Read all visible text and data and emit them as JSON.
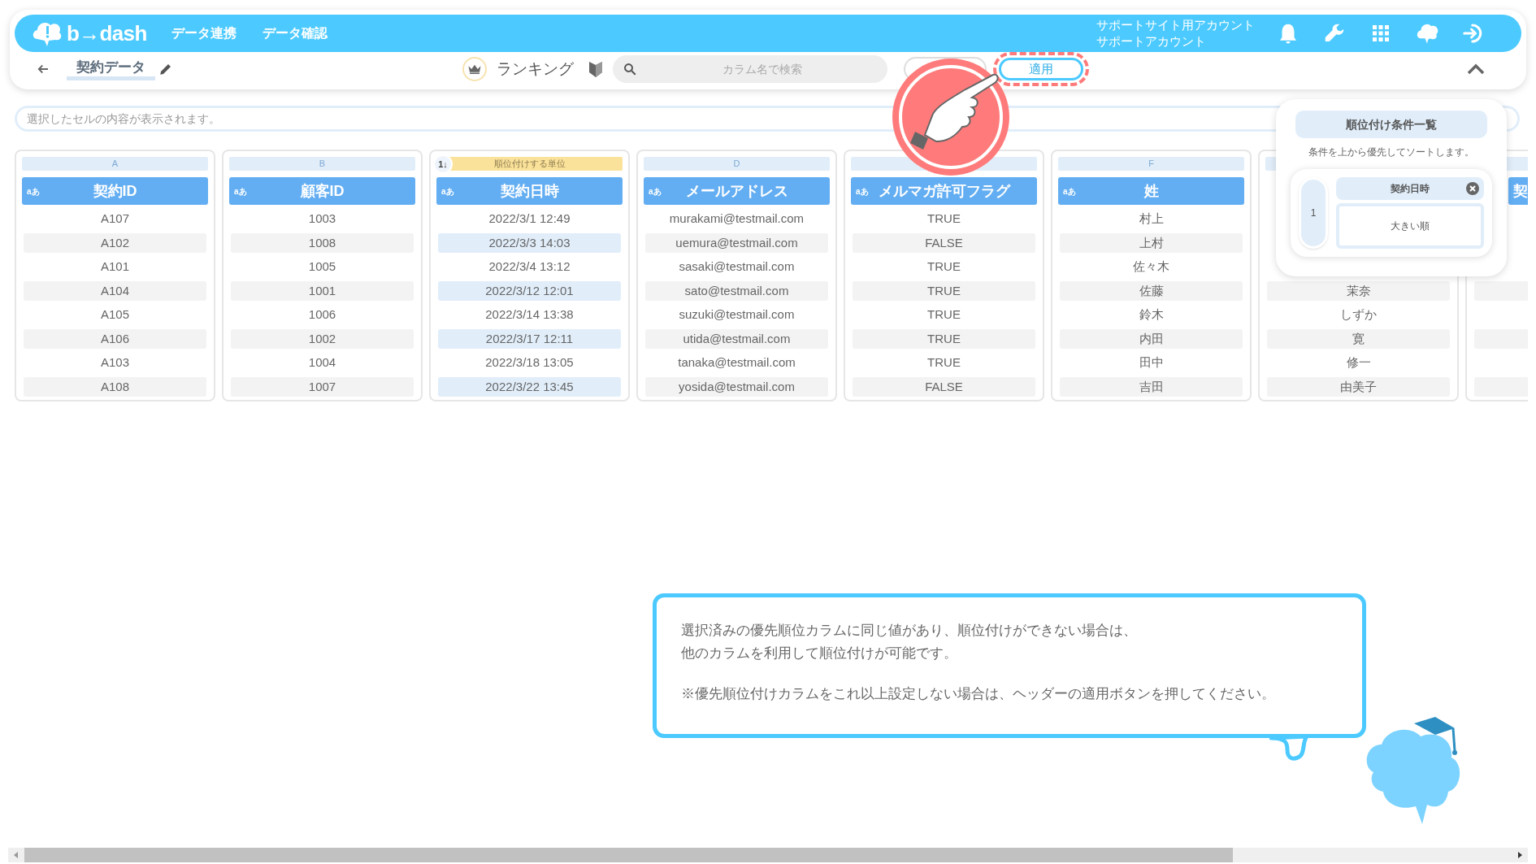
{
  "header": {
    "logo": "b→dash",
    "nav": [
      "データ連携",
      "データ確認"
    ],
    "account": [
      "サポートサイト用アカウント",
      "サポートアカウント"
    ]
  },
  "toolbar": {
    "title": "契約データ",
    "mode": "ランキング",
    "search": {
      "placeholder": "カラム名で検索"
    },
    "apply": "適用"
  },
  "cell_viewer": {
    "placeholder": "選択したセルの内容が表示されます。"
  },
  "ranking_label": {
    "order": "1↓",
    "text": "順位付けする単位"
  },
  "columns": [
    {
      "letter": "A",
      "header": "契約ID",
      "type_badge": "aあ",
      "ranked": false,
      "cells": [
        "A107",
        "A102",
        "A101",
        "A104",
        "A105",
        "A106",
        "A103",
        "A108"
      ]
    },
    {
      "letter": "B",
      "header": "顧客ID",
      "type_badge": "aあ",
      "ranked": false,
      "cells": [
        "1003",
        "1008",
        "1005",
        "1001",
        "1006",
        "1002",
        "1004",
        "1007"
      ]
    },
    {
      "header": "契約日時",
      "type_badge": "aあ",
      "ranked": true,
      "cells": [
        "2022/3/1 12:49",
        "2022/3/3 14:03",
        "2022/3/4 13:12",
        "2022/3/12 12:01",
        "2022/3/14 13:38",
        "2022/3/17 12:11",
        "2022/3/18 13:05",
        "2022/3/22 13:45"
      ]
    },
    {
      "letter": "D",
      "header": "メールアドレス",
      "type_badge": "aあ",
      "ranked": false,
      "cells": [
        "murakami@testmail.com",
        "uemura@testmail.com",
        "sasaki@testmail.com",
        "sato@testmail.com",
        "suzuki@testmail.com",
        "utida@testmail.com",
        "tanaka@testmail.com",
        "yosida@testmail.com"
      ]
    },
    {
      "header": "メルマガ許可フラグ",
      "type_badge": "aあ",
      "ranked": false,
      "cells": [
        "TRUE",
        "FALSE",
        "TRUE",
        "TRUE",
        "TRUE",
        "TRUE",
        "TRUE",
        "FALSE"
      ]
    },
    {
      "letter": "F",
      "header": "姓",
      "type_badge": "aあ",
      "ranked": false,
      "cells": [
        "村上",
        "上村",
        "佐々木",
        "佐藤",
        "鈴木",
        "内田",
        "田中",
        "吉田"
      ]
    },
    {
      "ranked": false,
      "cells": [
        "茉奈",
        "しずか",
        "寛",
        "修一",
        "由美子"
      ]
    },
    {
      "header": "契",
      "ranked": false
    }
  ],
  "ranking_panel": {
    "title": "順位付け条件一覧",
    "description": "条件を上から優先してソートします。",
    "conditions": [
      {
        "number": "1",
        "column": "契約日時",
        "order": "大きい順"
      }
    ]
  },
  "callout": {
    "paragraphs": [
      [
        "選択済みの優先順位カラムに同じ値があり、順位付けができない場合は、",
        "他のカラムを利用して順位付けが可能です。"
      ],
      [
        "※優先順位付けカラムをこれ以上設定しない場合は、ヘッダーの適用ボタンを押してください。"
      ]
    ]
  }
}
